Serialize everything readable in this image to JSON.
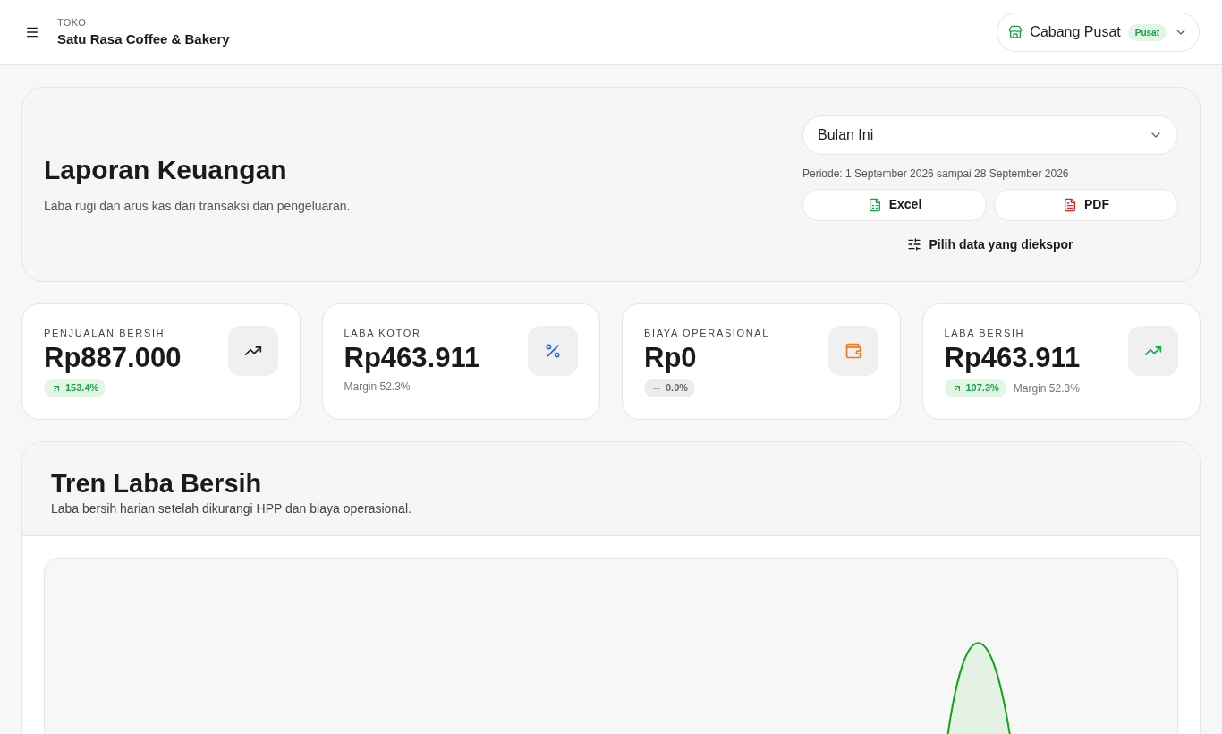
{
  "header": {
    "store_label": "TOKO",
    "store_name": "Satu Rasa Coffee & Bakery",
    "branch": {
      "name": "Cabang Pusat",
      "badge": "Pusat"
    }
  },
  "report": {
    "title": "Laporan Keuangan",
    "subtitle": "Laba rugi dan arus kas dari transaksi dan pengeluaran.",
    "period_select": "Bulan Ini",
    "period_text": "Periode: 1 September 2026 sampai 28 September 2026",
    "export_buttons": [
      {
        "kind": "excel",
        "label": "Excel"
      },
      {
        "kind": "pdf",
        "label": "PDF"
      }
    ],
    "choose_data": "Pilih data yang diekspor"
  },
  "stats": [
    {
      "label": "PENJUALAN BERSIH",
      "value": "Rp887.000",
      "kind": "trend",
      "badge": {
        "kind": "up",
        "text": "153.4%"
      }
    },
    {
      "label": "LABA KOTOR",
      "value": "Rp463.911",
      "kind": "percent",
      "note": "Margin 52.3%"
    },
    {
      "label": "BIAYA OPERASIONAL",
      "value": "Rp0",
      "kind": "wallet",
      "badge": {
        "kind": "flat",
        "text": "0.0%"
      }
    },
    {
      "label": "LABA BERSIH",
      "value": "Rp463.911",
      "kind": "profit",
      "badge": {
        "kind": "up",
        "text": "107.3%"
      },
      "note": "Margin 52.3%"
    }
  ],
  "trend": {
    "title": "Tren Laba Bersih",
    "subtitle": "Laba bersih harian setelah dikurangi HPP dan biaya operasional."
  }
}
